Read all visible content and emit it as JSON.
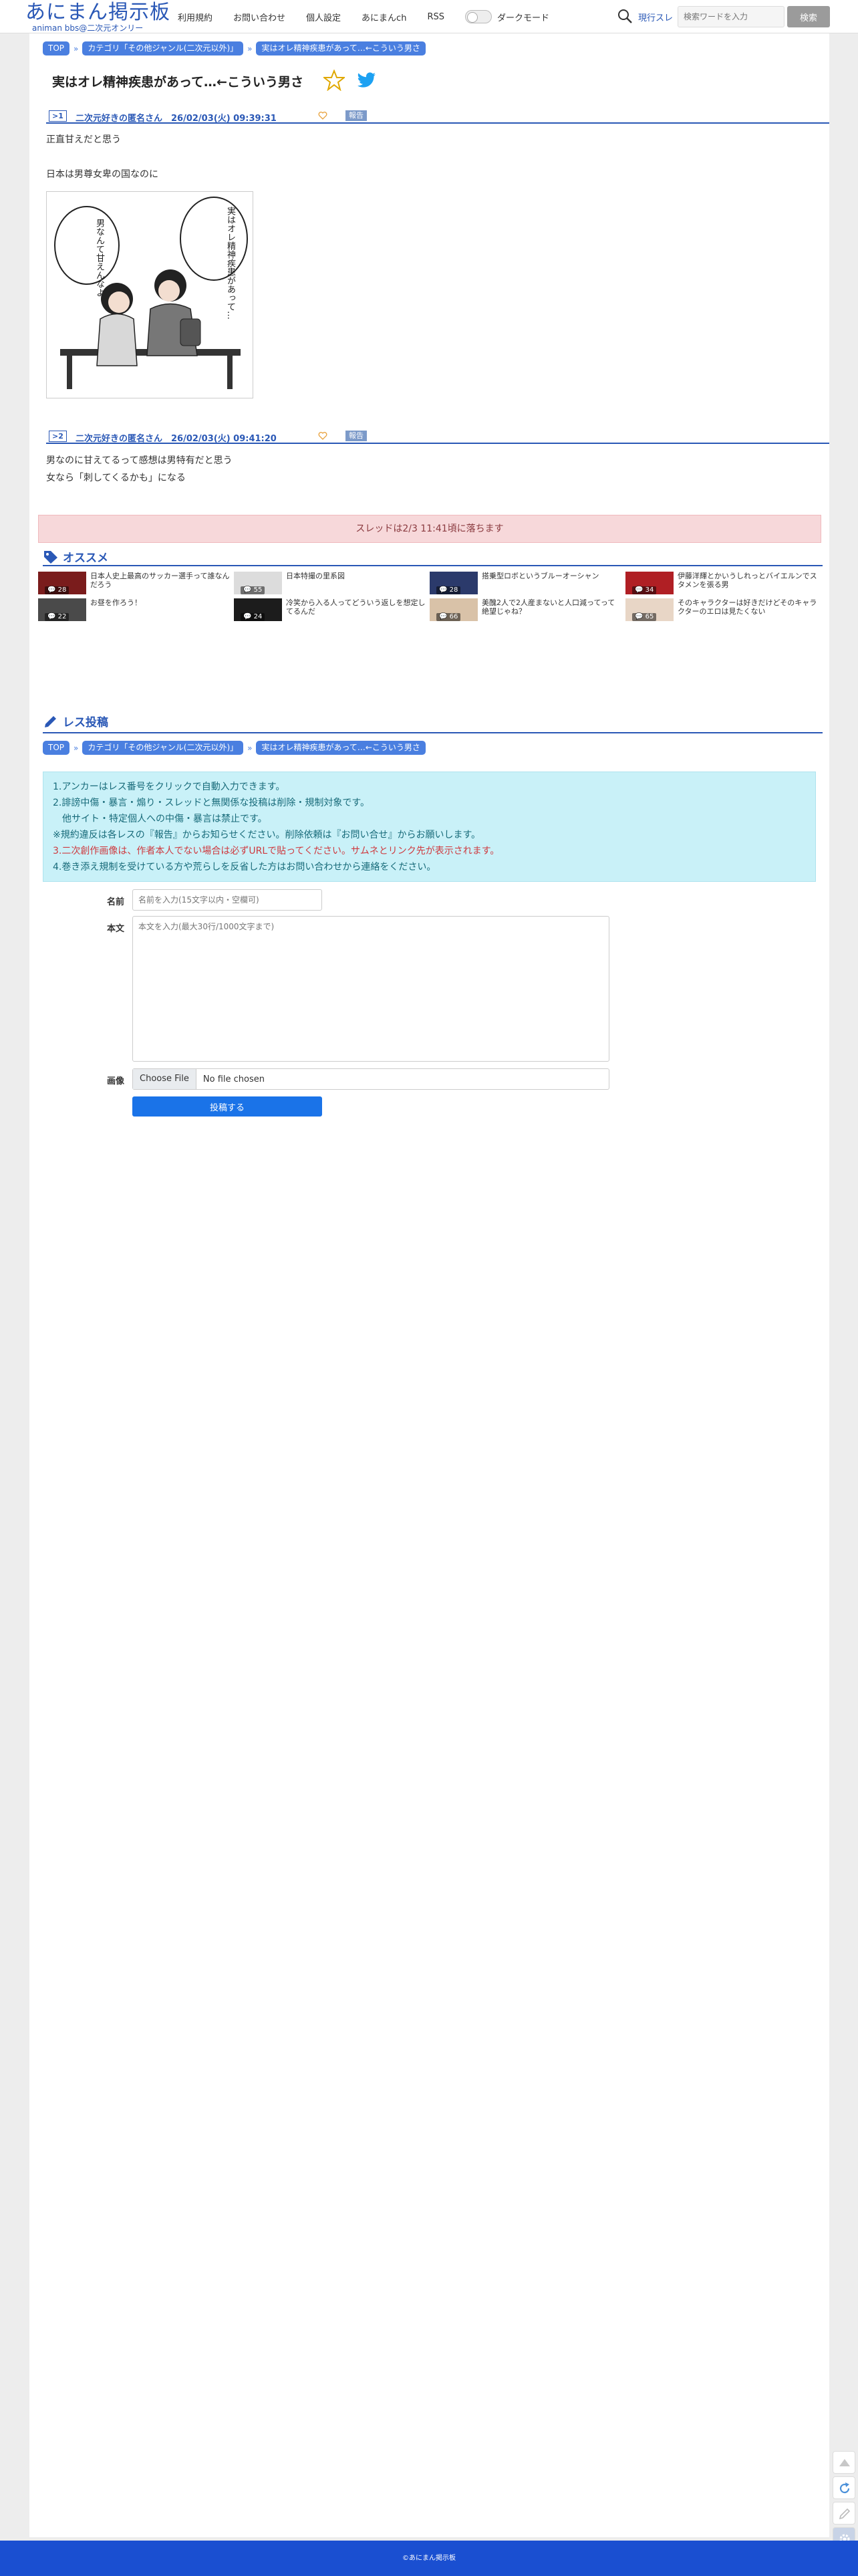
{
  "header": {
    "logo": "あにまん掲示板",
    "logo_sub": "animan bbs@二次元オンリー",
    "nav": [
      "利用規約",
      "お問い合わせ",
      "個人設定",
      "あにまんch",
      "RSS"
    ],
    "dark_mode_label": "ダークモード",
    "search_mode": "現行スレ",
    "search_placeholder": "検索ワードを入力",
    "search_button": "検索"
  },
  "breadcrumb": {
    "top": "TOP",
    "category": "カテゴリ「その他ジャンル(二次元以外)」",
    "thread": "実はオレ精神疾患があって…←こういう男さ"
  },
  "thread": {
    "title": "実はオレ精神疾患があって…←こういう男さ"
  },
  "posts": [
    {
      "num": ">1",
      "meta": "二次元好きの匿名さん　26/02/03(火) 09:39:31",
      "report": "報告",
      "lines": [
        "正直甘えだと思う",
        "",
        "日本は男尊女卑の国なのに"
      ]
    },
    {
      "num": ">2",
      "meta": "二次元好きの匿名さん　26/02/03(火) 09:41:20",
      "report": "報告",
      "lines": [
        "男なのに甘えてるって感想は男特有だと思う",
        "女なら「刺してくるかも」になる"
      ]
    }
  ],
  "image_speech": {
    "left": "男なんて甘えんなよ！",
    "right": "実はオレ精神疾患があって…"
  },
  "expire_notice": "スレッドは2/3 11:41頃に落ちます",
  "recommend": {
    "title": "オススメ",
    "items": [
      {
        "count": "28",
        "title": "日本人史上最高のサッカー選手って誰なんだろう"
      },
      {
        "count": "55",
        "title": "日本特撮の里系図"
      },
      {
        "count": "28",
        "title": "搭乗型ロボというブルーオーシャン"
      },
      {
        "count": "34",
        "title": "伊藤洋輝とかいうしれっとバイエルンでスタメンを張る男"
      },
      {
        "count": "22",
        "title": "お昼を作ろう！"
      },
      {
        "count": "24",
        "title": "冷笑から入る人ってどういう返しを想定してるんだ"
      },
      {
        "count": "66",
        "title": "美醜2人で2人産まないと人口減ってって絶望じゃね？"
      },
      {
        "count": "65",
        "title": "そのキャラクターは好きだけどそのキャラクターのエロは見たくない"
      }
    ]
  },
  "reply": {
    "title": "レス投稿",
    "rules": [
      "1.アンカーはレス番号をクリックで自動入力できます。",
      "2.誹謗中傷・暴言・煽り・スレッドと無関係な投稿は削除・規制対象です。",
      "　他サイト・特定個人への中傷・暴言は禁止です。",
      "※規約違反は各レスの『報告』からお知らせください。削除依頼は『お問い合せ』からお願いします。",
      "3.二次創作画像は、作者本人でない場合は必ずURLで貼ってください。サムネとリンク先が表示されます。",
      "4.巻き添え規制を受けている方や荒らしを反省した方はお問い合わせから連絡をください。"
    ],
    "name_label": "名前",
    "name_placeholder": "名前を入力(15文字以内・空欄可)",
    "body_label": "本文",
    "body_placeholder": "本文を入力(最大30行/1000文字まで)",
    "image_label": "画像",
    "file_button": "Choose File",
    "file_text": "No file chosen",
    "submit": "投稿する"
  },
  "footer": "©あにまん掲示板",
  "colors": {
    "brand": "#2a58b6",
    "crumb": "#4a7fe0",
    "footer": "#1a4fd1",
    "notice_bg": "#f7d8da",
    "info_bg": "#c9f1f8",
    "info_alert": "#cf3a3f",
    "submit": "#1a73e8"
  }
}
